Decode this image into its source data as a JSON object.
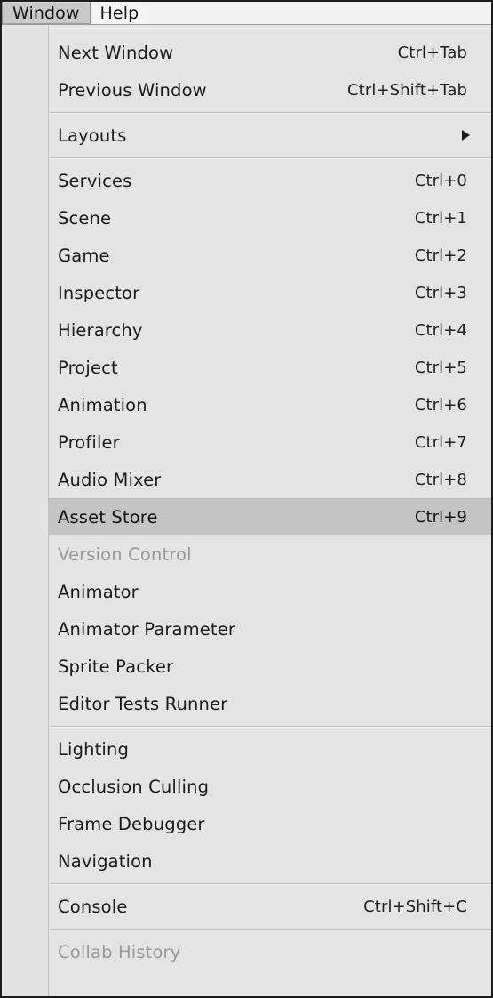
{
  "menubar": {
    "items": [
      {
        "label": "Window",
        "active": true
      },
      {
        "label": "Help",
        "active": false
      }
    ]
  },
  "dropdown": {
    "groups": [
      {
        "items": [
          {
            "label": "Next Window",
            "shortcut": "Ctrl+Tab"
          },
          {
            "label": "Previous Window",
            "shortcut": "Ctrl+Shift+Tab"
          }
        ]
      },
      {
        "items": [
          {
            "label": "Layouts",
            "shortcut": "",
            "submenu": true
          }
        ]
      },
      {
        "items": [
          {
            "label": "Services",
            "shortcut": "Ctrl+0"
          },
          {
            "label": "Scene",
            "shortcut": "Ctrl+1"
          },
          {
            "label": "Game",
            "shortcut": "Ctrl+2"
          },
          {
            "label": "Inspector",
            "shortcut": "Ctrl+3"
          },
          {
            "label": "Hierarchy",
            "shortcut": "Ctrl+4"
          },
          {
            "label": "Project",
            "shortcut": "Ctrl+5"
          },
          {
            "label": "Animation",
            "shortcut": "Ctrl+6"
          },
          {
            "label": "Profiler",
            "shortcut": "Ctrl+7"
          },
          {
            "label": "Audio Mixer",
            "shortcut": "Ctrl+8"
          },
          {
            "label": "Asset Store",
            "shortcut": "Ctrl+9",
            "selected": true
          },
          {
            "label": "Version Control",
            "shortcut": "",
            "disabled": true
          },
          {
            "label": "Animator",
            "shortcut": ""
          },
          {
            "label": "Animator Parameter",
            "shortcut": ""
          },
          {
            "label": "Sprite Packer",
            "shortcut": ""
          },
          {
            "label": "Editor Tests Runner",
            "shortcut": ""
          }
        ]
      },
      {
        "items": [
          {
            "label": "Lighting",
            "shortcut": ""
          },
          {
            "label": "Occlusion Culling",
            "shortcut": ""
          },
          {
            "label": "Frame Debugger",
            "shortcut": ""
          },
          {
            "label": "Navigation",
            "shortcut": ""
          }
        ]
      },
      {
        "items": [
          {
            "label": "Console",
            "shortcut": "Ctrl+Shift+C"
          }
        ]
      },
      {
        "items": [
          {
            "label": "Collab History",
            "shortcut": "",
            "disabled": true
          }
        ]
      }
    ]
  },
  "colors": {
    "panel_background": "#e4e4e4",
    "selected_row": "#c4c4c4",
    "menubar_active": "#c9c9c9",
    "text": "#1a1a1a",
    "text_disabled": "#989898",
    "separator": "#bcbcbc",
    "outer_border": "#1d1d1d"
  }
}
